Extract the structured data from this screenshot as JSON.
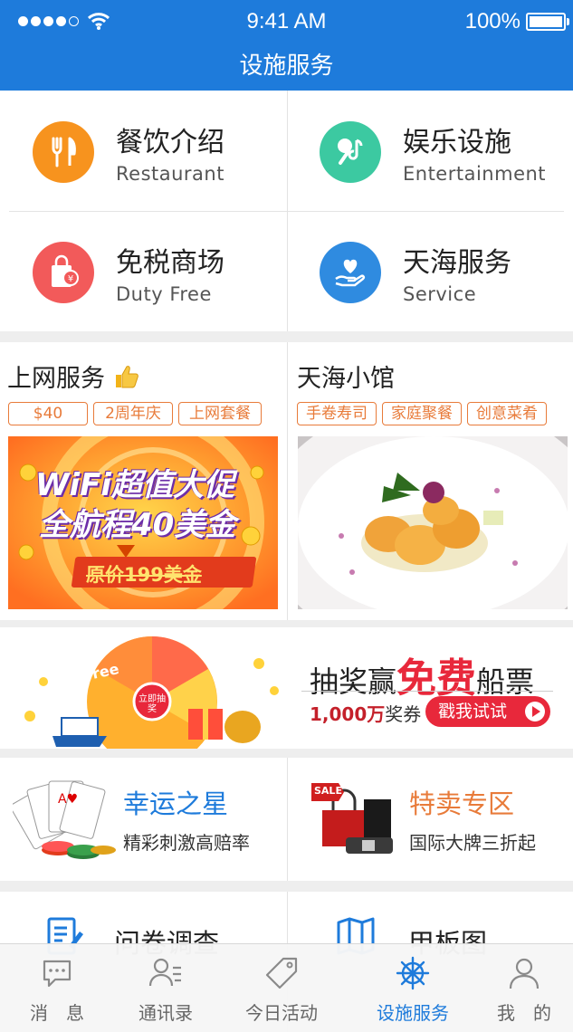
{
  "status_bar": {
    "time": "9:41 AM",
    "battery": "100%"
  },
  "header": {
    "title": "设施服务"
  },
  "services": [
    {
      "zh": "餐饮介绍",
      "en": "Restaurant",
      "icon": "fork-knife-icon",
      "color": "#f7931e"
    },
    {
      "zh": "娱乐设施",
      "en": "Entertainment",
      "icon": "microphone-icon",
      "color": "#3cc9a1"
    },
    {
      "zh": "免税商场",
      "en": "Duty Free",
      "icon": "shopping-bag-icon",
      "color": "#f25a5a"
    },
    {
      "zh": "天海服务",
      "en": "Service",
      "icon": "heart-hand-icon",
      "color": "#2f8be0"
    }
  ],
  "cards": {
    "internet": {
      "title": "上网服务",
      "tags": [
        "$40",
        "2周年庆",
        "上网套餐"
      ],
      "banner": {
        "line1": "WiFi超值大促",
        "line2": "全航程40美金",
        "sub": "原价199美金"
      }
    },
    "bistro": {
      "title": "天海小馆",
      "tags": [
        "手卷寿司",
        "家庭聚餐",
        "创意菜肴"
      ]
    }
  },
  "lottery": {
    "title_pre": "抽奖赢",
    "title_big": "免费",
    "title_post": "船票",
    "amount": "1,000万",
    "amount_rest": "奖券",
    "button": "戳我试试",
    "wheel_free": "Free",
    "wheel_center": "立即抽奖"
  },
  "promos": [
    {
      "title": "幸运之星",
      "sub": "精彩刺激高赔率",
      "color": "#1e7bdb"
    },
    {
      "title": "特卖专区",
      "sub": "国际大牌三折起",
      "color": "#e87b3a",
      "badge": "SALE"
    }
  ],
  "more": [
    {
      "title": "问卷调查",
      "icon": "survey-icon"
    },
    {
      "title": "甲板图",
      "icon": "map-icon"
    }
  ],
  "tabs": [
    {
      "label": "消　息",
      "icon": "message-icon",
      "active": false
    },
    {
      "label": "通讯录",
      "icon": "contacts-icon",
      "active": false
    },
    {
      "label": "今日活动",
      "icon": "tag-icon",
      "active": false
    },
    {
      "label": "设施服务",
      "icon": "helm-icon",
      "active": true
    },
    {
      "label": "我　的",
      "icon": "person-icon",
      "active": false
    }
  ]
}
